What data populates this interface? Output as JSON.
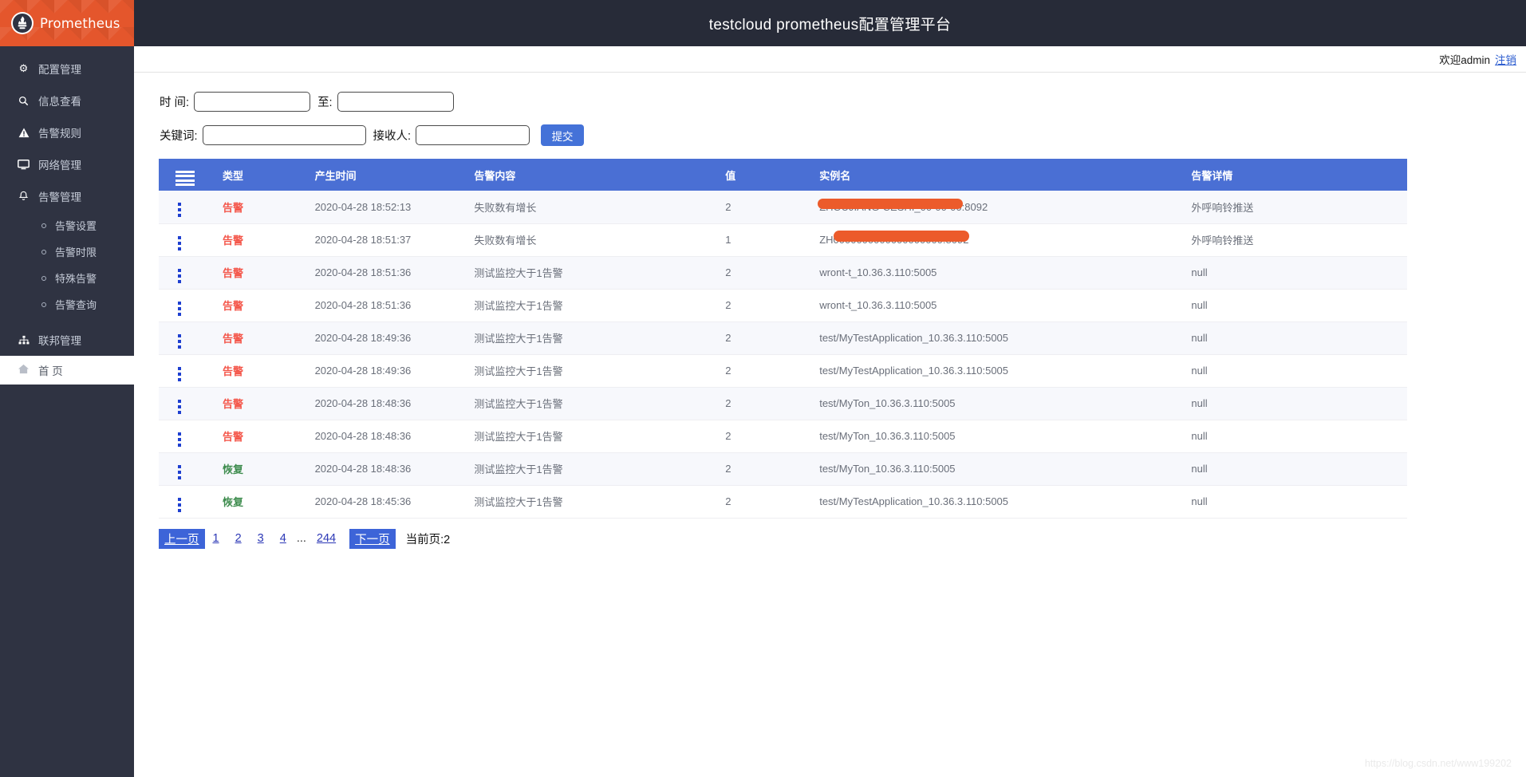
{
  "brand": {
    "name": "Prometheus",
    "logo_icon": "prometheus-torch-icon",
    "bg": "#e4562c"
  },
  "topbar": {
    "title": "testcloud prometheus配置管理平台",
    "bg": "#272b38"
  },
  "welcome": {
    "text": "欢迎admin",
    "logout_label": "注销"
  },
  "sidebar": {
    "items": [
      {
        "label": "配置管理",
        "icon": "gear-icon"
      },
      {
        "label": "信息查看",
        "icon": "search-icon"
      },
      {
        "label": "告警规则",
        "icon": "warning-triangle-icon"
      },
      {
        "label": "网络管理",
        "icon": "monitor-icon"
      },
      {
        "label": "告警管理",
        "icon": "bell-icon"
      }
    ],
    "sub_items": [
      {
        "label": "告警设置",
        "icon": "circle-bullet-icon"
      },
      {
        "label": "告警时限",
        "icon": "circle-bullet-icon"
      },
      {
        "label": "特殊告警",
        "icon": "circle-bullet-icon"
      },
      {
        "label": "告警查询",
        "icon": "circle-bullet-icon"
      }
    ],
    "federation": {
      "label": "联邦管理",
      "icon": "sitemap-icon"
    },
    "home": {
      "label": "首 页",
      "icon": "home-icon"
    }
  },
  "search_form": {
    "time_label": "时 间:",
    "time_start_value": "",
    "time_start_placeholder": "",
    "to_label": "至:",
    "time_end_value": "",
    "time_end_placeholder": "",
    "keyword_label": "关键词:",
    "keyword_value": "",
    "keyword_placeholder": "",
    "receiver_label": "接收人:",
    "receiver_value": "",
    "receiver_placeholder": "",
    "submit_label": "提交"
  },
  "table": {
    "header_bg": "#4a6fd4",
    "menu_icon": "hamburger-icon",
    "columns": [
      "",
      "类型",
      "产生时间",
      "告警内容",
      "值",
      "实例名",
      "告警详情"
    ],
    "rows": [
      {
        "row_icon": "kebab-menu-icon",
        "type": "告警",
        "type_kind": "alarm",
        "time": "2020-04-28 18:52:13",
        "content": "失败数有增长",
        "value": "2",
        "instance": "ZHOUJIANG-CESHI_00-00-00:8092",
        "instance_redacted": true,
        "detail": "外呼响铃推送"
      },
      {
        "row_icon": "kebab-menu-icon",
        "type": "告警",
        "type_kind": "alarm",
        "time": "2020-04-28 18:51:37",
        "content": "失败数有增长",
        "value": "1",
        "instance": "ZH0000000000000000000:8092",
        "instance_redacted": true,
        "detail": "外呼响铃推送"
      },
      {
        "row_icon": "kebab-menu-icon",
        "type": "告警",
        "type_kind": "alarm",
        "time": "2020-04-28 18:51:36",
        "content": "测试监控大于1告警",
        "value": "2",
        "instance": "wront-t_10.36.3.110:5005",
        "instance_redacted": false,
        "detail": "null"
      },
      {
        "row_icon": "kebab-menu-icon",
        "type": "告警",
        "type_kind": "alarm",
        "time": "2020-04-28 18:51:36",
        "content": "测试监控大于1告警",
        "value": "2",
        "instance": "wront-t_10.36.3.110:5005",
        "instance_redacted": false,
        "detail": "null"
      },
      {
        "row_icon": "kebab-menu-icon",
        "type": "告警",
        "type_kind": "alarm",
        "time": "2020-04-28 18:49:36",
        "content": "测试监控大于1告警",
        "value": "2",
        "instance": "test/MyTestApplication_10.36.3.110:5005",
        "instance_redacted": false,
        "detail": "null"
      },
      {
        "row_icon": "kebab-menu-icon",
        "type": "告警",
        "type_kind": "alarm",
        "time": "2020-04-28 18:49:36",
        "content": "测试监控大于1告警",
        "value": "2",
        "instance": "test/MyTestApplication_10.36.3.110:5005",
        "instance_redacted": false,
        "detail": "null"
      },
      {
        "row_icon": "kebab-menu-icon",
        "type": "告警",
        "type_kind": "alarm",
        "time": "2020-04-28 18:48:36",
        "content": "测试监控大于1告警",
        "value": "2",
        "instance": "test/MyTon_10.36.3.110:5005",
        "instance_redacted": false,
        "detail": "null"
      },
      {
        "row_icon": "kebab-menu-icon",
        "type": "告警",
        "type_kind": "alarm",
        "time": "2020-04-28 18:48:36",
        "content": "测试监控大于1告警",
        "value": "2",
        "instance": "test/MyTon_10.36.3.110:5005",
        "instance_redacted": false,
        "detail": "null"
      },
      {
        "row_icon": "kebab-menu-icon",
        "type": "恢复",
        "type_kind": "recover",
        "time": "2020-04-28 18:48:36",
        "content": "测试监控大于1告警",
        "value": "2",
        "instance": "test/MyTon_10.36.3.110:5005",
        "instance_redacted": false,
        "detail": "null"
      },
      {
        "row_icon": "kebab-menu-icon",
        "type": "恢复",
        "type_kind": "recover",
        "time": "2020-04-28 18:45:36",
        "content": "测试监控大于1告警",
        "value": "2",
        "instance": "test/MyTestApplication_10.36.3.110:5005",
        "instance_redacted": false,
        "detail": "null"
      }
    ]
  },
  "pagination": {
    "prev_label": "上一页",
    "next_label": "下一页",
    "pages": [
      "1",
      "2",
      "3",
      "4"
    ],
    "ellipsis": "...",
    "last_page": "244",
    "current_label": "当前页:2"
  },
  "watermark": {
    "text": "https://blog.csdn.net/www199202"
  },
  "colors": {
    "brand_orange": "#e4562c",
    "sidebar_dark": "#2f3342",
    "table_header_blue": "#4a6fd4",
    "alarm_red": "#f4564a",
    "recover_green": "#3e8c4e",
    "button_blue": "#4472d8",
    "redact_orange": "#ec5b2b"
  }
}
